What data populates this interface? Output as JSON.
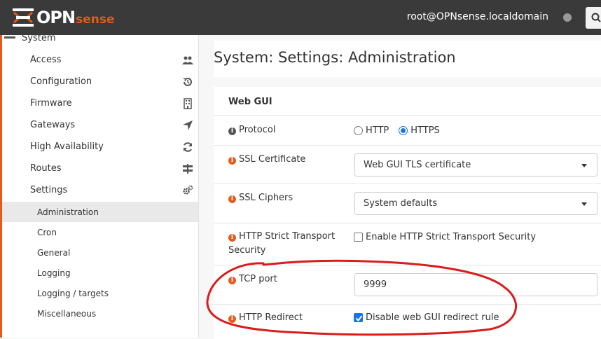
{
  "header": {
    "logo_text": "OPN",
    "logo_sense": "sense",
    "user": "root@OPNsense.localdomain",
    "icons": [
      "opnsense-logo-icon",
      "status-dot-icon",
      "search-icon"
    ]
  },
  "sidebar": {
    "section": "System",
    "items": [
      {
        "label": "Access",
        "icon": "users-icon"
      },
      {
        "label": "Configuration",
        "icon": "history-icon"
      },
      {
        "label": "Firmware",
        "icon": "building-icon"
      },
      {
        "label": "Gateways",
        "icon": "location-arrow-icon"
      },
      {
        "label": "High Availability",
        "icon": "refresh-icon"
      },
      {
        "label": "Routes",
        "icon": "signpost-icon"
      },
      {
        "label": "Settings",
        "icon": "cogs-icon"
      }
    ],
    "subitems": [
      {
        "label": "Administration",
        "active": true
      },
      {
        "label": "Cron"
      },
      {
        "label": "General"
      },
      {
        "label": "Logging"
      },
      {
        "label": "Logging / targets"
      },
      {
        "label": "Miscellaneous"
      }
    ]
  },
  "main": {
    "title": "System: Settings: Administration",
    "section": "Web GUI",
    "protocol": {
      "label": "Protocol",
      "options": [
        "HTTP",
        "HTTPS"
      ],
      "selected": "HTTPS"
    },
    "ssl_certificate": {
      "label": "SSL Certificate",
      "value": "Web GUI TLS certificate"
    },
    "ssl_ciphers": {
      "label": "SSL Ciphers",
      "value": "System defaults"
    },
    "hsts": {
      "label_line1": "HTTP Strict Transport",
      "label_line2": "Security",
      "checkbox_label": "Enable HTTP Strict Transport Security",
      "checked": false
    },
    "tcp_port": {
      "label": "TCP port",
      "value": "9999"
    },
    "http_redirect": {
      "label": "HTTP Redirect",
      "checkbox_label": "Disable web GUI redirect rule",
      "checked": true
    }
  },
  "colors": {
    "accent": "#e8591a",
    "topbar": "#3a3a3a",
    "check": "#1a73e8",
    "annotation": "#d91c1c"
  }
}
